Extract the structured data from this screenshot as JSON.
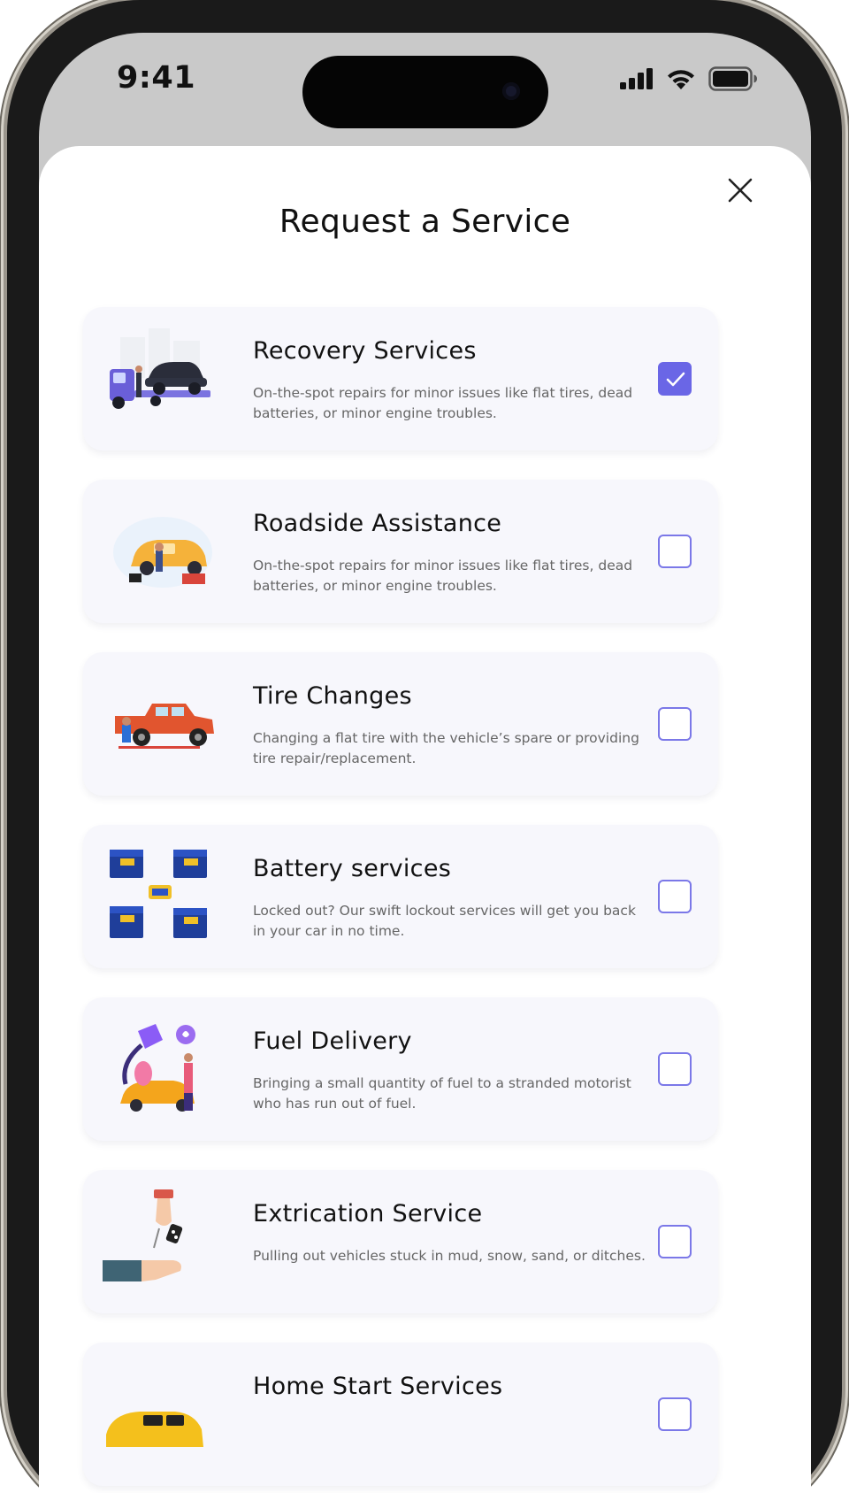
{
  "status_bar": {
    "time": "9:41",
    "icons": [
      "cellular-signal-icon",
      "wifi-icon",
      "battery-icon"
    ]
  },
  "sheet": {
    "title": "Request a Service",
    "close_icon": "close-icon"
  },
  "colors": {
    "accent": "#6a66e6",
    "card_background": "#f7f7fc",
    "screen_background": "#c9c9c9"
  },
  "services": [
    {
      "title": "Recovery Services",
      "description": "On-the-spot repairs for minor issues like flat tires, dead batteries, or minor engine troubles.",
      "checked": true,
      "illustration": "tow-truck-illustration"
    },
    {
      "title": "Roadside Assistance",
      "description": "On-the-spot repairs for minor issues like flat tires, dead batteries, or minor engine troubles.",
      "checked": false,
      "illustration": "roadside-repair-illustration"
    },
    {
      "title": "Tire Changes",
      "description": "Changing a flat tire with the vehicle’s spare or providing tire repair/replacement.",
      "checked": false,
      "illustration": "tire-change-illustration"
    },
    {
      "title": "Battery services",
      "description": "Locked out? Our swift lockout services will get you back in your car in no time.",
      "checked": false,
      "illustration": "car-batteries-illustration"
    },
    {
      "title": "Fuel Delivery",
      "description": "Bringing a small quantity of fuel to a stranded motorist who has run out of fuel.",
      "checked": false,
      "illustration": "fuel-delivery-illustration"
    },
    {
      "title": "Extrication Service",
      "description": "Pulling out vehicles stuck in mud, snow, sand, or ditches.",
      "checked": false,
      "illustration": "car-keys-handover-illustration"
    },
    {
      "title": "Home Start Services",
      "description": "",
      "checked": false,
      "illustration": "yellow-car-illustration"
    }
  ]
}
